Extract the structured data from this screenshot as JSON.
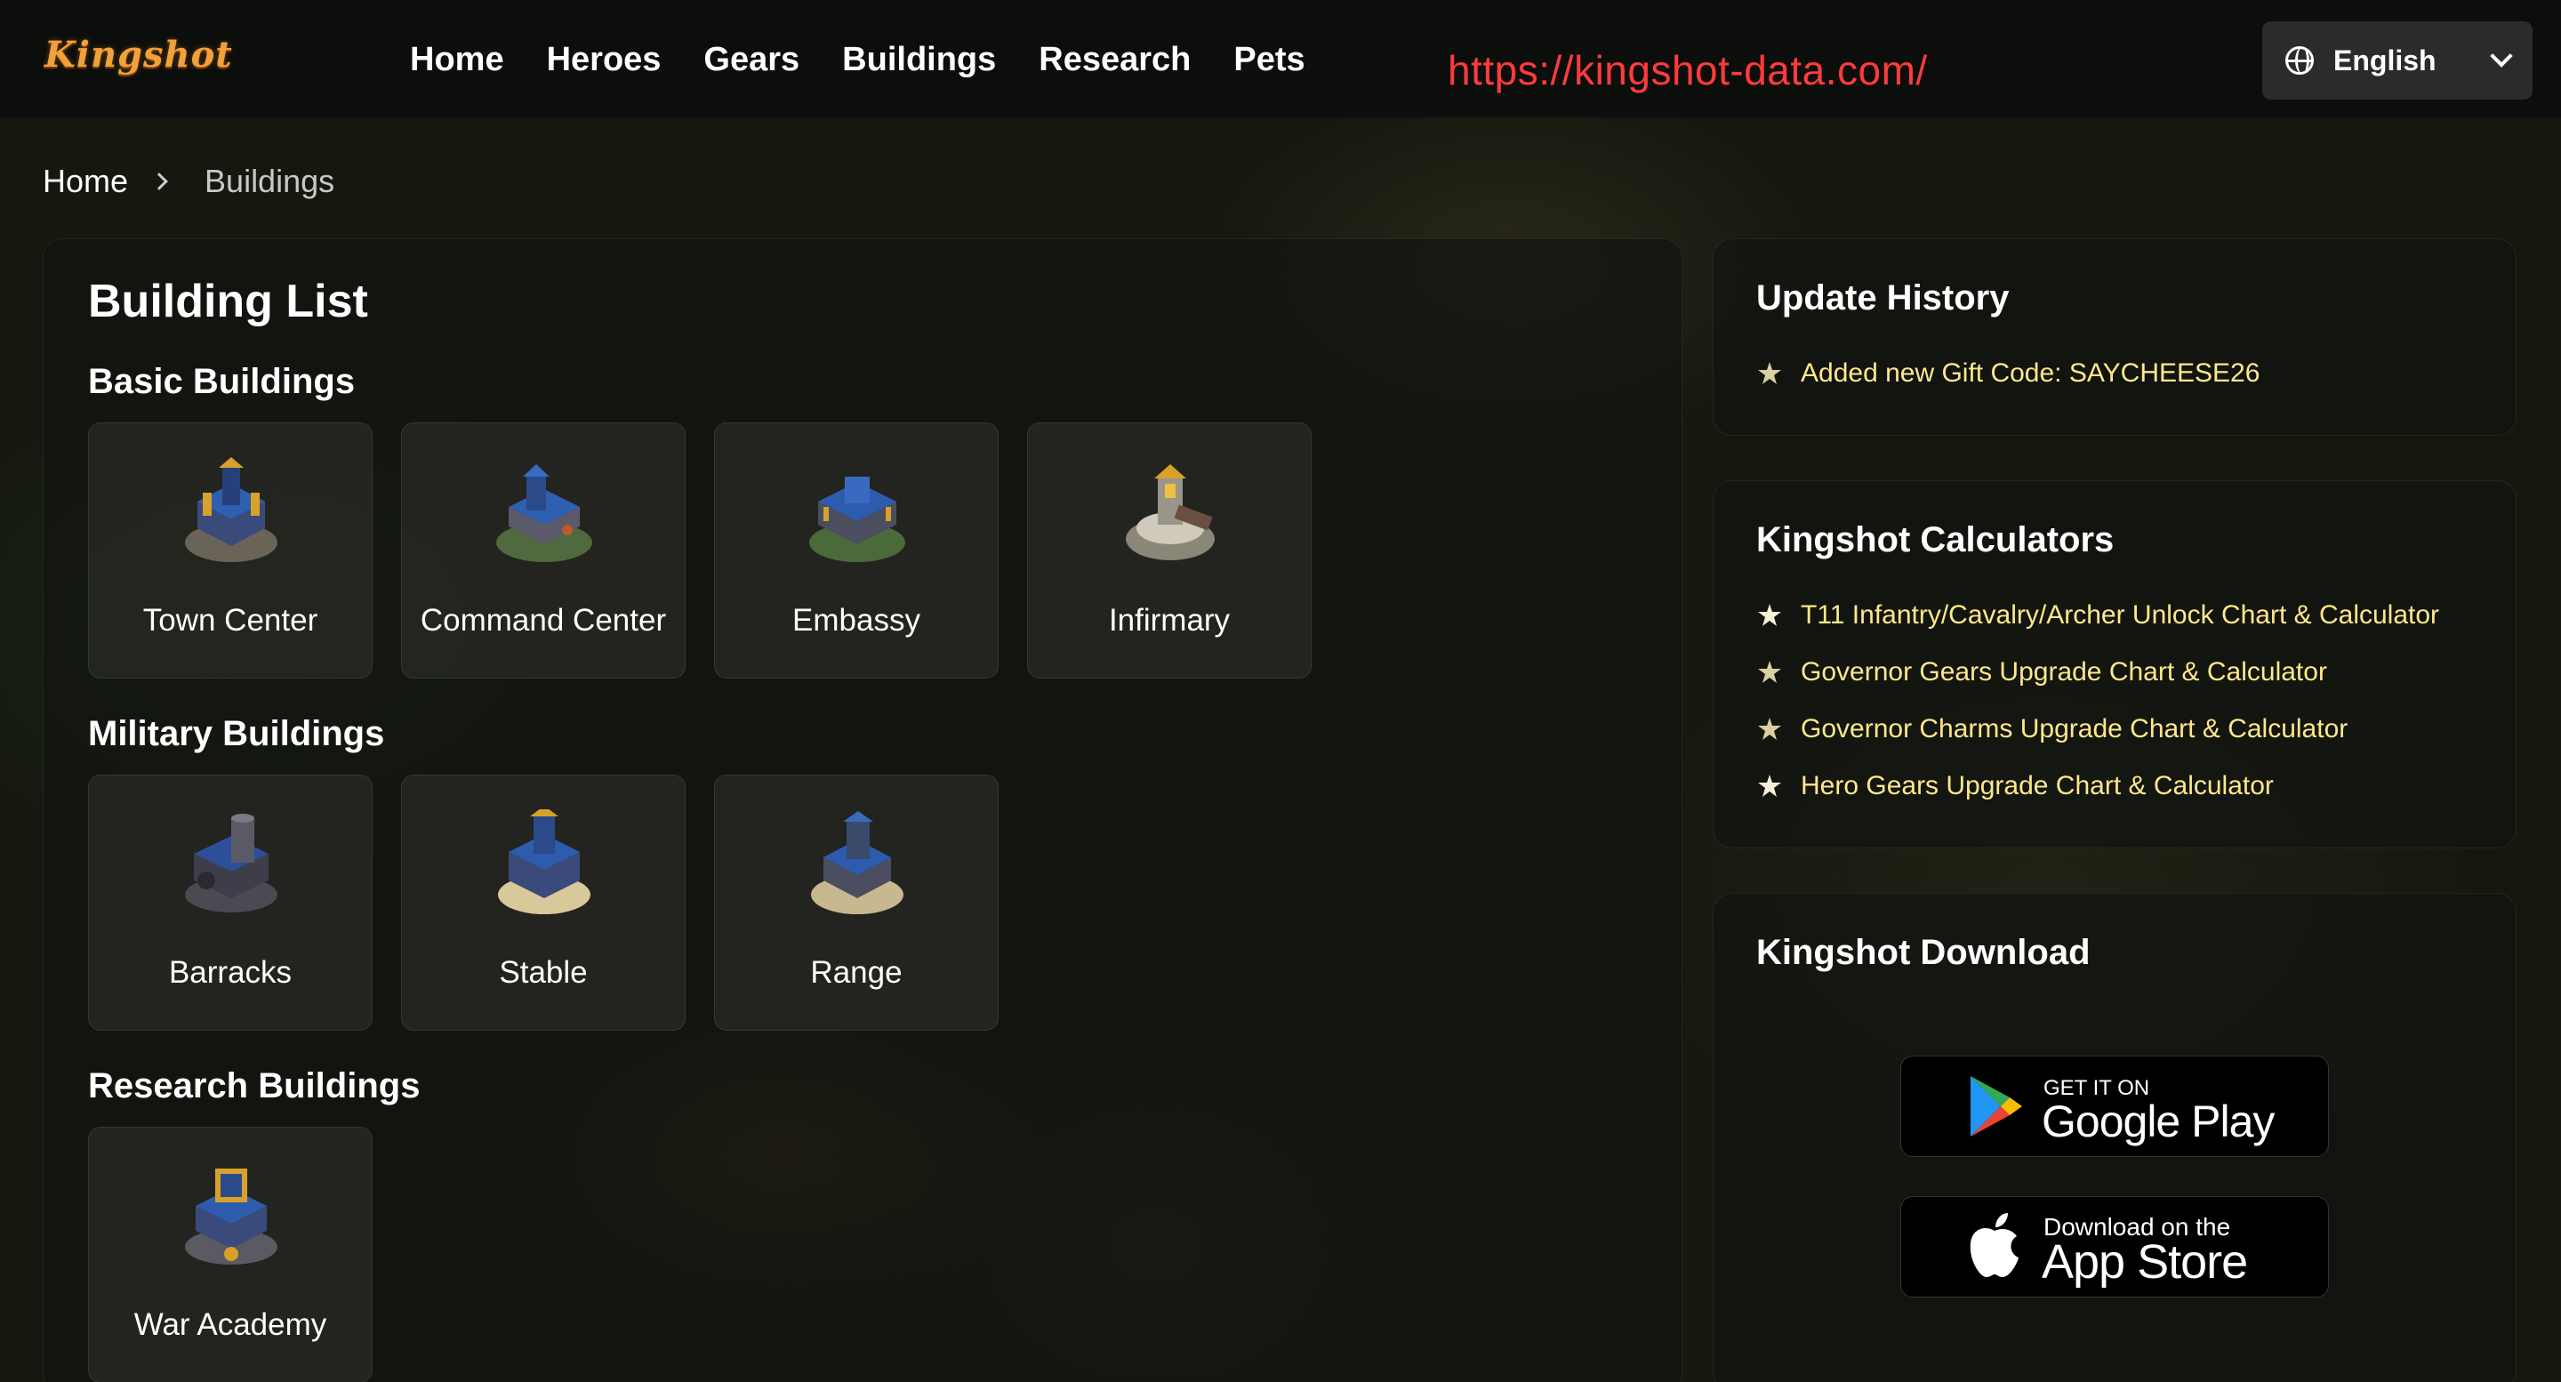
{
  "header": {
    "logo_text": "Kingshot",
    "nav": [
      "Home",
      "Heroes",
      "Gears",
      "Buildings",
      "Research",
      "Pets"
    ],
    "url_note": "https://kingshot-data.com/",
    "language": "English"
  },
  "breadcrumb": {
    "home": "Home",
    "current": "Buildings"
  },
  "main": {
    "title": "Building List",
    "sections": {
      "basic": {
        "title": "Basic Buildings",
        "items": [
          "Town Center",
          "Command Center",
          "Embassy",
          "Infirmary"
        ]
      },
      "military": {
        "title": "Military Buildings",
        "items": [
          "Barracks",
          "Stable",
          "Range"
        ]
      },
      "research": {
        "title": "Research Buildings",
        "items": [
          "War Academy"
        ]
      }
    }
  },
  "update_history": {
    "title": "Update History",
    "items": [
      "Added new Gift Code: SAYCHEESE26"
    ]
  },
  "calculators": {
    "title": "Kingshot Calculators",
    "items": [
      "T11 Infantry/Cavalry/Archer Unlock Chart & Calculator",
      "Governor Gears Upgrade Chart & Calculator",
      "Governor Charms Upgrade Chart & Calculator",
      "Hero Gears Upgrade Chart & Calculator"
    ]
  },
  "download": {
    "title": "Kingshot Download",
    "google_small": "GET IT ON",
    "google_big": "Google Play",
    "apple_small": "Download on the",
    "apple_big": "App Store"
  },
  "colors": {
    "link": "#ffe88a",
    "url_note": "#ff3b3b",
    "logo": "#f2a13a"
  }
}
